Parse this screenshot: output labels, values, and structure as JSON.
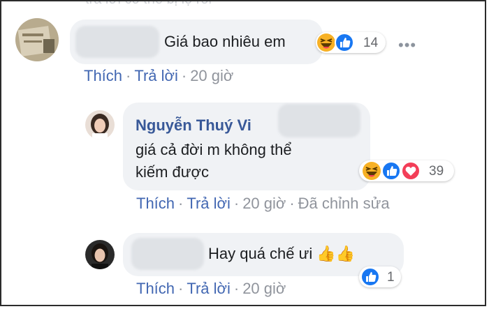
{
  "comments": [
    {
      "text": "Giá bao nhiêu em",
      "reaction_count": "14",
      "actions": {
        "like": "Thích",
        "reply": "Trả lời",
        "time": "20 giờ"
      },
      "more": "•••"
    },
    {
      "author": "Nguyễn Thuý Vi",
      "text_line1": "giá cả đời m không thể",
      "text_line2": "kiếm được",
      "reaction_count": "39",
      "actions": {
        "like": "Thích",
        "reply": "Trả lời",
        "time": "20 giờ",
        "edited": "Đã chỉnh sửa"
      }
    },
    {
      "text": "Hay quá chế ưi 👍👍",
      "reaction_count": "1",
      "actions": {
        "like": "Thích",
        "reply": "Trả lời",
        "time": "20 giờ"
      }
    }
  ],
  "separator": "·",
  "colors": {
    "link": "#4267b2",
    "author": "#385898",
    "bubble": "#f0f2f5",
    "like_blue": "#1877f2",
    "love_red": "#f33e58",
    "haha_yellow": "#f7b125"
  }
}
